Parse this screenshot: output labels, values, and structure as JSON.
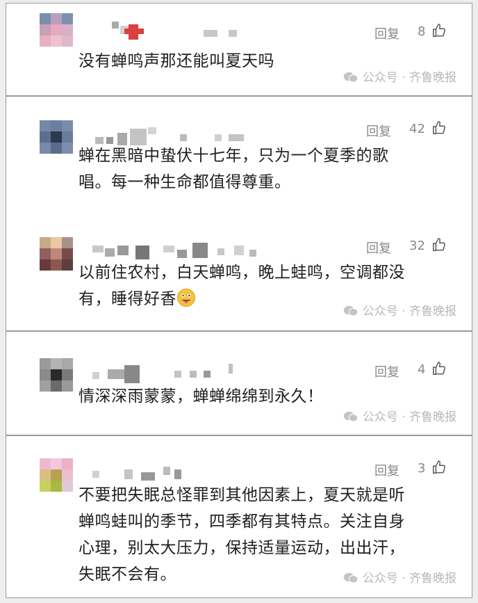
{
  "reply_label": "回复",
  "watermark": "公众号 · 齐鲁晚报",
  "comments": [
    {
      "likes": "8",
      "lines": [
        "没有蝉鸣声那还能叫夏天吗"
      ]
    },
    {
      "likes": "42",
      "lines": [
        "蝉在黑暗中蛰伏十七年，只为一个夏季的歌",
        "唱。每一种生命都值得尊重。"
      ]
    },
    {
      "likes": "32",
      "lines": [
        "以前住农村，白天蝉鸣，晚上蛙鸣，空调都没",
        "有，睡得好香"
      ]
    },
    {
      "likes": "4",
      "lines": [
        "情深深雨蒙蒙，蝉蝉绵绵到永久！"
      ]
    },
    {
      "likes": "3",
      "lines": [
        "不要把失眠总怪罪到其他因素上，夏天就是听",
        "蝉鸣蛙叫的季节，四季都有其特点。关注自身",
        "心理，别太大压力，保持适量运动，出出汗，",
        "失眠不会有。"
      ]
    }
  ],
  "icons": {
    "like": "thumbs-up-icon",
    "wechat": "wechat-icon",
    "emoji": "tongue-out-emoji-icon"
  },
  "colors": {
    "text": "#1f1f1f",
    "meta": "#888888",
    "watermark": "#b8b8b8",
    "border": "#9a9a9a"
  }
}
